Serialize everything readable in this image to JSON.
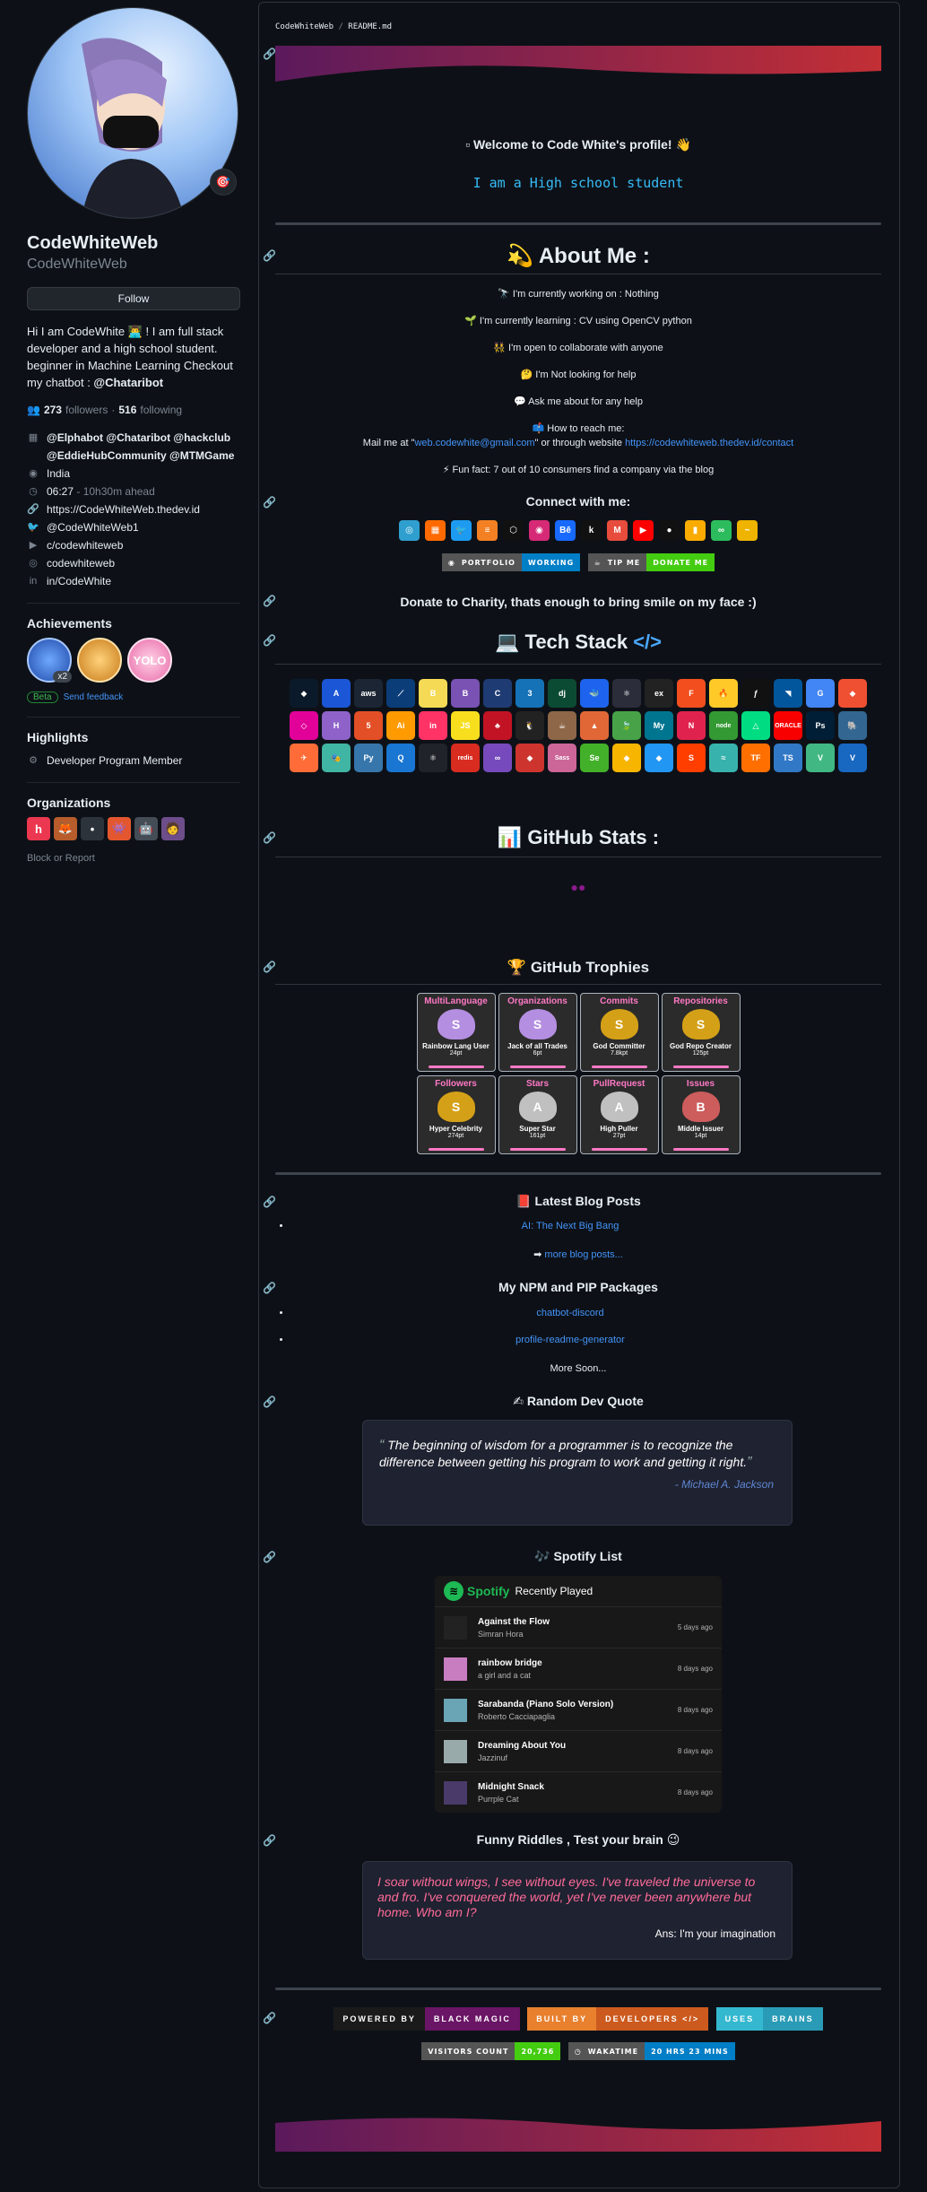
{
  "profile": {
    "full_name": "CodeWhiteWeb",
    "username": "CodeWhiteWeb",
    "status_emoji": "🎯",
    "follow_label": "Follow",
    "bio_text": "Hi I am CodeWhite 👨‍💻 ! I am full stack developer and a high school student. beginner in Machine Learning Checkout my chatbot : ",
    "bio_link": "@Chataribot",
    "followers_count": "273",
    "followers_label": "followers",
    "dot": "·",
    "following_count": "516",
    "following_label": "following",
    "org_line1": "@Elphabot @Chataribot @hackclub",
    "org_line2": "@EddieHubCommunity @MTMGame",
    "location": "India",
    "local_time": "06:27",
    "time_ahead": "- 10h30m ahead",
    "website": "https://CodeWhiteWeb.thedev.id",
    "twitter": "@CodeWhiteWeb1",
    "youtube": "c/codewhiteweb",
    "instagram": "codewhiteweb",
    "linkedin": "in/CodeWhite"
  },
  "achievements": {
    "title": "Achievements",
    "multiplier": "x2",
    "yolo": "YOLO",
    "beta": "Beta",
    "feedback": "Send feedback"
  },
  "highlights": {
    "title": "Highlights",
    "item": "Developer Program Member"
  },
  "organizations": {
    "title": "Organizations",
    "block": "Block or Report"
  },
  "readme": {
    "path_user": "CodeWhiteWeb",
    "path_sep": "/",
    "path_file": "README.md",
    "welcome": "Welcome to Code White's profile!",
    "typing": "I am a High school student",
    "about_title": "About Me :",
    "about": {
      "working": "🔭 I'm currently working on : Nothing",
      "learning": "🌱 I'm currently learning : CV using OpenCV python",
      "collab": "👯 I'm open to collaborate with anyone",
      "help": "🤔 I'm Not looking for help",
      "ask": "💬 Ask me about for any help",
      "reach": "📫 How to reach me:",
      "mail_prefix": "Mail me at \"",
      "email": "web.codewhite@gmail.com",
      "mail_mid": "\" or through website ",
      "site": "https://codewhiteweb.thedev.id/contact",
      "fun": "⚡ Fun fact: 7 out of 10 consumers find a company via the blog"
    },
    "connect_title": "Connect with me:",
    "portfolio_left": "PORTFOLIO",
    "portfolio_right": "WORKING",
    "tip_left": "TIP ME",
    "tip_right": "DONATE ME",
    "charity": "Donate to Charity, thats enough to bring smile on my face :)",
    "tech_title": "Tech Stack",
    "stats_title": "GitHub Stats :",
    "trophy_title": "GitHub Trophies",
    "blog_title": "Latest Blog Posts",
    "blog_post": "AI: The Next Big Bang",
    "blog_more": "more blog posts...",
    "npm_title": "My NPM and PIP Packages",
    "pkg1": "chatbot-discord",
    "pkg2": "profile-readme-generator",
    "more_soon": "More Soon...",
    "quote_title": "Random Dev Quote",
    "quote_text": "The beginning of wisdom for a programmer is to recognize the difference between getting his program to work and getting it right.",
    "quote_author": "- Michael A. Jackson",
    "spotify_title": "Spotify List",
    "spotify_brand": "Spotify",
    "recently_played": "Recently Played",
    "riddle_title": "Funny Riddles , Test your brain 😉",
    "riddle_text": "I soar without wings, I see without eyes. I've traveled the universe to and fro. I've conquered the world, yet I've never been anywhere but home. Who am I?",
    "riddle_answer": "Ans: I'm your imagination",
    "b1_left": "POWERED BY",
    "b1_right": "BLACK MAGIC",
    "b2_left": "BUILT BY",
    "b2_right": "DEVELOPERS </>",
    "b3_left": "USES",
    "b3_right": "BRAINS",
    "visitors_label": "VISITORS COUNT",
    "visitors_count": "20,736",
    "wakatime_label": "WAKATIME",
    "wakatime_value": "20 HRS 23 MINS"
  },
  "trophies": [
    {
      "cat": "MultiLanguage",
      "rank": "S",
      "name": "Rainbow Lang User",
      "pts": "24pt",
      "color": "#b48ee0"
    },
    {
      "cat": "Organizations",
      "rank": "S",
      "name": "Jack of all Trades",
      "pts": "6pt",
      "color": "#b48ee0"
    },
    {
      "cat": "Commits",
      "rank": "S",
      "name": "God Committer",
      "pts": "7.8kpt",
      "color": "#d4a017"
    },
    {
      "cat": "Repositories",
      "rank": "S",
      "name": "God Repo Creator",
      "pts": "125pt",
      "color": "#d4a017"
    },
    {
      "cat": "Followers",
      "rank": "S",
      "name": "Hyper Celebrity",
      "pts": "274pt",
      "color": "#d4a017"
    },
    {
      "cat": "Stars",
      "rank": "A",
      "name": "Super Star",
      "pts": "161pt",
      "color": "#c0c0c0"
    },
    {
      "cat": "PullRequest",
      "rank": "A",
      "name": "High Puller",
      "pts": "27pt",
      "color": "#c0c0c0"
    },
    {
      "cat": "Issues",
      "rank": "B",
      "name": "Middle Issuer",
      "pts": "14pt",
      "color": "#cd5c5c"
    }
  ],
  "tracks": [
    {
      "name": "Against the Flow",
      "artist": "Simran Hora",
      "ago": "5 days ago",
      "cover": "#222"
    },
    {
      "name": "rainbow bridge",
      "artist": "a girl and a cat",
      "ago": "8 days ago",
      "cover": "#c87dc0"
    },
    {
      "name": "Sarabanda (Piano Solo Version)",
      "artist": "Roberto Cacciapaglia",
      "ago": "8 days ago",
      "cover": "#6aa5b5"
    },
    {
      "name": "Dreaming About You",
      "artist": "Jazzinuf",
      "ago": "8 days ago",
      "cover": "#9aa"
    },
    {
      "name": "Midnight Snack",
      "artist": "Purrple Cat",
      "ago": "8 days ago",
      "cover": "#4a3a6a"
    }
  ],
  "connect_icons": [
    {
      "name": "codepen-icon",
      "label": "◎",
      "color": "#2f9fcf"
    },
    {
      "name": "codesandbox-icon",
      "label": "▦",
      "color": "#ff6a00"
    },
    {
      "name": "twitter-icon",
      "label": "🐦",
      "color": "#1d9bf0"
    },
    {
      "name": "stackoverflow-icon",
      "label": "≡",
      "color": "#f48024"
    },
    {
      "name": "codesandbox-cube-icon",
      "label": "⬡",
      "color": "#111"
    },
    {
      "name": "instagram-icon",
      "label": "◉",
      "color": "#d62976"
    },
    {
      "name": "behance-icon",
      "label": "Bē",
      "color": "#1769ff"
    },
    {
      "name": "kaggle-icon",
      "label": "k",
      "color": "#111"
    },
    {
      "name": "medium-icon",
      "label": "M",
      "color": "#e74c3c"
    },
    {
      "name": "youtube-icon",
      "label": "▶",
      "color": "#ff0000"
    },
    {
      "name": "hashnode-icon",
      "label": "●",
      "color": "#111"
    },
    {
      "name": "google-analytics-icon",
      "label": "▮",
      "color": "#f9ab00"
    },
    {
      "name": "leetcode-icon",
      "label": "∞",
      "color": "#2cbb5d"
    },
    {
      "name": "wave-icon",
      "label": "~",
      "color": "#eeb400"
    }
  ],
  "tech_icons": [
    {
      "name": "android-icon",
      "label": "◆",
      "color": "#0b1a2a"
    },
    {
      "name": "angular-icon",
      "label": "A",
      "color": "#1a56d6"
    },
    {
      "name": "aws-icon",
      "label": "aws",
      "color": "#1b2533"
    },
    {
      "name": "azure-icon",
      "label": "⟋",
      "color": "#0b3d78"
    },
    {
      "name": "babel-icon",
      "label": "B",
      "color": "#f5da55"
    },
    {
      "name": "bootstrap-icon",
      "label": "B",
      "color": "#7952b3"
    },
    {
      "name": "c-icon",
      "label": "C",
      "color": "#1f3b73"
    },
    {
      "name": "css3-icon",
      "label": "3",
      "color": "#1572b6"
    },
    {
      "name": "django-icon",
      "label": "dj",
      "color": "#0c4b33"
    },
    {
      "name": "docker-icon",
      "label": "🐳",
      "color": "#1d63ed"
    },
    {
      "name": "electron-icon",
      "label": "⚛",
      "color": "#2b2e3a"
    },
    {
      "name": "express-icon",
      "label": "ex",
      "color": "#222"
    },
    {
      "name": "figma-icon",
      "label": "F",
      "color": "#f24e1e"
    },
    {
      "name": "firebase-icon",
      "label": "🔥",
      "color": "#ffca28"
    },
    {
      "name": "flask-icon",
      "label": "ƒ",
      "color": "#111"
    },
    {
      "name": "flutter-icon",
      "label": "◥",
      "color": "#02569b"
    },
    {
      "name": "gcp-icon",
      "label": "G",
      "color": "#4285f4"
    },
    {
      "name": "git-icon",
      "label": "◆",
      "color": "#f05032"
    },
    {
      "name": "graphql-icon",
      "label": "◇",
      "color": "#e10098"
    },
    {
      "name": "hadoop-icon",
      "label": "H",
      "color": "#8e62c9"
    },
    {
      "name": "html5-icon",
      "label": "5",
      "color": "#e34f26"
    },
    {
      "name": "illustrator-icon",
      "label": "Ai",
      "color": "#ff9a00"
    },
    {
      "name": "invision-icon",
      "label": "in",
      "color": "#ff3366"
    },
    {
      "name": "javascript-icon",
      "label": "JS",
      "color": "#f7df1e"
    },
    {
      "name": "jest-icon",
      "label": "♣",
      "color": "#c21325"
    },
    {
      "name": "linux-icon",
      "label": "🐧",
      "color": "#222"
    },
    {
      "name": "mocha-icon",
      "label": "☕",
      "color": "#8d6748"
    },
    {
      "name": "matlab-icon",
      "label": "▲",
      "color": "#e16737"
    },
    {
      "name": "mongodb-icon",
      "label": "🍃",
      "color": "#47a248"
    },
    {
      "name": "mysql-icon",
      "label": "My",
      "color": "#00758f"
    },
    {
      "name": "nestjs-icon",
      "label": "N",
      "color": "#e0234e"
    },
    {
      "name": "nodejs-icon",
      "label": "node",
      "color": "#339933"
    },
    {
      "name": "nuxt-icon",
      "label": "△",
      "color": "#00dc82"
    },
    {
      "name": "oracle-icon",
      "label": "ORACLE",
      "color": "#f80000"
    },
    {
      "name": "photoshop-icon",
      "label": "Ps",
      "color": "#001e36"
    },
    {
      "name": "postgresql-icon",
      "label": "🐘",
      "color": "#336791"
    },
    {
      "name": "postman-icon",
      "label": "✈",
      "color": "#ff6c37"
    },
    {
      "name": "puppeteer-icon",
      "label": "🎭",
      "color": "#40b5a4"
    },
    {
      "name": "python-icon",
      "label": "Py",
      "color": "#3776ab"
    },
    {
      "name": "quasar-icon",
      "label": "Q",
      "color": "#1976d2"
    },
    {
      "name": "react-icon",
      "label": "⚛",
      "color": "#20232a"
    },
    {
      "name": "redis-icon",
      "label": "redis",
      "color": "#d82c20"
    },
    {
      "name": "redux-icon",
      "label": "∞",
      "color": "#764abc"
    },
    {
      "name": "ruby-icon",
      "label": "◆",
      "color": "#cc342d"
    },
    {
      "name": "sass-icon",
      "label": "Sass",
      "color": "#cc6699"
    },
    {
      "name": "selenium-icon",
      "label": "Se",
      "color": "#43b02a"
    },
    {
      "name": "sketch-icon",
      "label": "◆",
      "color": "#f7b500"
    },
    {
      "name": "solidity-icon",
      "label": "◆",
      "color": "#2196f3"
    },
    {
      "name": "svelte-icon",
      "label": "S",
      "color": "#ff3e00"
    },
    {
      "name": "tailwind-icon",
      "label": "≈",
      "color": "#38b2ac"
    },
    {
      "name": "tensorflow-icon",
      "label": "TF",
      "color": "#ff6f00"
    },
    {
      "name": "typescript-icon",
      "label": "TS",
      "color": "#3178c6"
    },
    {
      "name": "vue-icon",
      "label": "V",
      "color": "#41b883"
    },
    {
      "name": "vuetify-icon",
      "label": "V",
      "color": "#1867c0"
    }
  ],
  "orgs": [
    {
      "name": "org-hackclub",
      "label": "h",
      "color": "#ec3750"
    },
    {
      "name": "org-chataribot",
      "label": "🦊",
      "color": "#b85c2c"
    },
    {
      "name": "org-elphabot",
      "label": "•",
      "color": "#2d333b"
    },
    {
      "name": "org-mtmgame",
      "label": "👾",
      "color": "#e4572e"
    },
    {
      "name": "org-eddiehub",
      "label": "🤖",
      "color": "#444c56"
    },
    {
      "name": "org-other",
      "label": "🧑",
      "color": "#6e4d8b"
    }
  ]
}
